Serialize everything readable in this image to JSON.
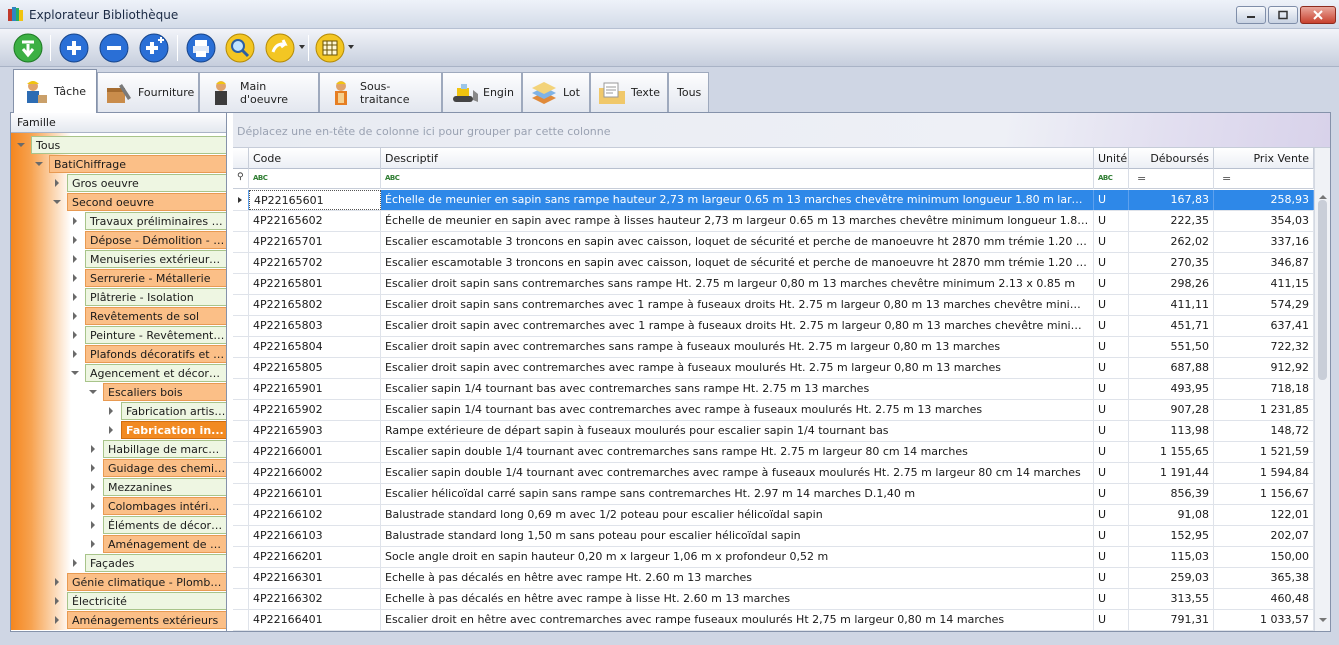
{
  "window": {
    "title": "Explorateur Bibliothèque"
  },
  "colors": {
    "accent": "#2e88e8",
    "tree_orange": "#f4861f",
    "tree_green": "#eef6e2",
    "selected_node": "#f28a22"
  },
  "toolbar": {
    "buttons": [
      {
        "name": "import-button",
        "icon": "green-download-icon"
      },
      {
        "name": "add-button",
        "icon": "plus-circle-icon"
      },
      {
        "name": "remove-button",
        "icon": "minus-circle-icon"
      },
      {
        "name": "add-child-button",
        "icon": "plus-plus-icon"
      },
      {
        "name": "print-button",
        "icon": "printer-icon"
      },
      {
        "name": "search-button",
        "icon": "magnifier-icon"
      },
      {
        "name": "export-button",
        "icon": "arrow-icon"
      },
      {
        "name": "columns-button",
        "icon": "columns-icon"
      }
    ]
  },
  "tabs": [
    {
      "label": "Tâche",
      "active": true
    },
    {
      "label": "Fourniture"
    },
    {
      "label": "Main d'oeuvre"
    },
    {
      "label": "Sous-traitance"
    },
    {
      "label": "Engin"
    },
    {
      "label": "Lot"
    },
    {
      "label": "Texte"
    },
    {
      "label": "Tous"
    }
  ],
  "tree": {
    "header": "Famille",
    "nodes": [
      {
        "label": "Tous",
        "level": 0,
        "state": "open",
        "style": "green"
      },
      {
        "label": "BatiChiffrage",
        "level": 1,
        "state": "open",
        "style": "orange"
      },
      {
        "label": "Gros oeuvre",
        "level": 2,
        "state": "closed",
        "style": "green"
      },
      {
        "label": "Second oeuvre",
        "level": 2,
        "state": "open",
        "style": "orange"
      },
      {
        "label": "Travaux préliminaires et ...",
        "level": 3,
        "state": "closed",
        "style": "green"
      },
      {
        "label": "Dépose - Démolition - Ne...",
        "level": 3,
        "state": "closed",
        "style": "orange"
      },
      {
        "label": "Menuiseries extérieures ...",
        "level": 3,
        "state": "closed",
        "style": "green"
      },
      {
        "label": "Serrurerie - Métallerie",
        "level": 3,
        "state": "closed",
        "style": "orange"
      },
      {
        "label": "Plâtrerie - Isolation",
        "level": 3,
        "state": "closed",
        "style": "green"
      },
      {
        "label": "Revêtements de sol",
        "level": 3,
        "state": "closed",
        "style": "orange"
      },
      {
        "label": "Peinture - Revêtements ...",
        "level": 3,
        "state": "closed",
        "style": "green"
      },
      {
        "label": "Plafonds décoratifs et ac...",
        "level": 3,
        "state": "closed",
        "style": "orange"
      },
      {
        "label": "Agencement et décoration",
        "level": 3,
        "state": "open",
        "style": "green"
      },
      {
        "label": "Escaliers bois",
        "level": 4,
        "state": "open",
        "style": "orange"
      },
      {
        "label": "Fabrication artisa...",
        "level": 5,
        "state": "closed",
        "style": "green"
      },
      {
        "label": "Fabrication in...",
        "level": 5,
        "state": "closed",
        "style": "sel"
      },
      {
        "label": "Habillage de marches...",
        "level": 4,
        "state": "closed",
        "style": "green"
      },
      {
        "label": "Guidage des chemine...",
        "level": 4,
        "state": "closed",
        "style": "orange"
      },
      {
        "label": "Mezzanines",
        "level": 4,
        "state": "closed",
        "style": "green"
      },
      {
        "label": "Colombages intérieurs",
        "level": 4,
        "state": "closed",
        "style": "orange"
      },
      {
        "label": "Éléments de décorati...",
        "level": 4,
        "state": "closed",
        "style": "green"
      },
      {
        "label": "Aménagement de pla...",
        "level": 4,
        "state": "closed",
        "style": "orange"
      },
      {
        "label": "Façades",
        "level": 3,
        "state": "closed",
        "style": "green"
      },
      {
        "label": "Génie climatique - Plomberie ...",
        "level": 2,
        "state": "closed",
        "style": "orange"
      },
      {
        "label": "Électricité",
        "level": 2,
        "state": "closed",
        "style": "green"
      },
      {
        "label": "Aménagements extérieurs",
        "level": 2,
        "state": "closed",
        "style": "orange"
      }
    ]
  },
  "grid": {
    "group_hint": "Déplacez une en-tête de colonne ici pour grouper par cette colonne",
    "columns": {
      "code": "Code",
      "desc": "Descriptif",
      "unit": "Unité",
      "cost": "Déboursés",
      "price": "Prix Vente"
    },
    "rows": [
      {
        "code": "4P22165601",
        "desc": "Échelle de meunier en sapin sans rampe hauteur 2,73 m largeur 0.65 m 13 marches chevêtre minimum longueur 1.80 m largeur 0.70 m",
        "unit": "U",
        "cost": "167,83",
        "price": "258,93",
        "selected": true
      },
      {
        "code": "4P22165602",
        "desc": "Échelle de meunier en sapin avec rampe à lisses hauteur 2,73 m largeur 0.65 m 13 marches chevêtre minimum longueur 1.80 m largeur 0.70 m",
        "unit": "U",
        "cost": "222,35",
        "price": "354,03"
      },
      {
        "code": "4P22165701",
        "desc": "Escalier escamotable 3 troncons en sapin avec caisson, loquet de sécurité et perche de manoeuvre ht 2870 mm trémie 1.20 x 0.60 m",
        "unit": "U",
        "cost": "262,02",
        "price": "337,16"
      },
      {
        "code": "4P22165702",
        "desc": "Escalier escamotable 3 troncons en sapin avec caisson, loquet de sécurité et perche de manoeuvre ht 2870 mm trémie 1.20 x 0.60 m trappe isola...",
        "unit": "U",
        "cost": "270,35",
        "price": "346,87"
      },
      {
        "code": "4P22165801",
        "desc": "Escalier droit sapin sans contremarches sans rampe Ht. 2.75 m largeur 0,80 m 13 marches chevêtre minimum 2.13 x 0.85 m",
        "unit": "U",
        "cost": "298,26",
        "price": "411,15"
      },
      {
        "code": "4P22165802",
        "desc": "Escalier droit sapin sans contremarches avec 1 rampe à fuseaux droits Ht. 2.75 m largeur 0,80 m 13 marches chevêtre minimun 2.13 x 0.85 m",
        "unit": "U",
        "cost": "411,11",
        "price": "574,29"
      },
      {
        "code": "4P22165803",
        "desc": "Escalier droit sapin avec contremarches avec 1 rampe à fuseaux droits Ht. 2.75 m largeur 0,80 m 13 marches chevêtre minimum 2.13 x 0.85 m",
        "unit": "U",
        "cost": "451,71",
        "price": "637,41"
      },
      {
        "code": "4P22165804",
        "desc": "Escalier droit sapin avec contremarches sans rampe à fuseaux moulurés Ht. 2.75 m largeur 0,80 m 13 marches",
        "unit": "U",
        "cost": "551,50",
        "price": "722,32"
      },
      {
        "code": "4P22165805",
        "desc": "Escalier droit sapin avec contremarches avec rampe à fuseaux moulurés Ht. 2.75 m largeur 0,80 m 13 marches",
        "unit": "U",
        "cost": "687,88",
        "price": "912,92"
      },
      {
        "code": "4P22165901",
        "desc": "Escalier sapin 1/4 tournant bas avec contremarches sans rampe Ht. 2.75 m 13 marches",
        "unit": "U",
        "cost": "493,95",
        "price": "718,18"
      },
      {
        "code": "4P22165902",
        "desc": "Escalier sapin 1/4 tournant bas avec contremarches avec rampe à fuseaux moulurés Ht. 2.75 m 13 marches",
        "unit": "U",
        "cost": "907,28",
        "price": "1 231,85"
      },
      {
        "code": "4P22165903",
        "desc": "Rampe extérieure de départ sapin à fuseaux moulurés pour escalier sapin 1/4 tournant bas",
        "unit": "U",
        "cost": "113,98",
        "price": "148,72"
      },
      {
        "code": "4P22166001",
        "desc": "Escalier sapin double 1/4 tournant avec contremarches sans rampe Ht. 2.75 m largeur 80 cm 14 marches",
        "unit": "U",
        "cost": "1 155,65",
        "price": "1 521,59"
      },
      {
        "code": "4P22166002",
        "desc": "Escalier sapin double 1/4 tournant avec contremarches avec rampe à fuseaux moulurés Ht. 2.75 m largeur 80 cm 14 marches",
        "unit": "U",
        "cost": "1 191,44",
        "price": "1 594,84"
      },
      {
        "code": "4P22166101",
        "desc": "Escalier hélicoïdal carré sapin sans rampe sans contremarches Ht. 2.97 m 14 marches D.1,40 m",
        "unit": "U",
        "cost": "856,39",
        "price": "1 156,67"
      },
      {
        "code": "4P22166102",
        "desc": "Balustrade standard long 0,69 m avec 1/2 poteau pour escalier hélicoïdal sapin",
        "unit": "U",
        "cost": "91,08",
        "price": "122,01"
      },
      {
        "code": "4P22166103",
        "desc": "Balustrade standard long 1,50 m sans poteau pour escalier hélicoïdal sapin",
        "unit": "U",
        "cost": "152,95",
        "price": "202,07"
      },
      {
        "code": "4P22166201",
        "desc": "Socle angle droit en sapin hauteur 0,20 m x largeur 1,06 m x profondeur 0,52 m",
        "unit": "U",
        "cost": "115,03",
        "price": "150,00"
      },
      {
        "code": "4P22166301",
        "desc": "Echelle à pas décalés en hêtre avec rampe Ht. 2.60 m 13 marches",
        "unit": "U",
        "cost": "259,03",
        "price": "365,38"
      },
      {
        "code": "4P22166302",
        "desc": "Echelle à pas décalés en hêtre avec rampe à lisse Ht. 2.60 m 13 marches",
        "unit": "U",
        "cost": "313,55",
        "price": "460,48"
      },
      {
        "code": "4P22166401",
        "desc": "Escalier droit en hêtre avec contremarches avec rampe fuseaux moulurés Ht 2,75 m largeur 0,80 m 14 marches",
        "unit": "U",
        "cost": "791,31",
        "price": "1 033,57"
      }
    ]
  }
}
